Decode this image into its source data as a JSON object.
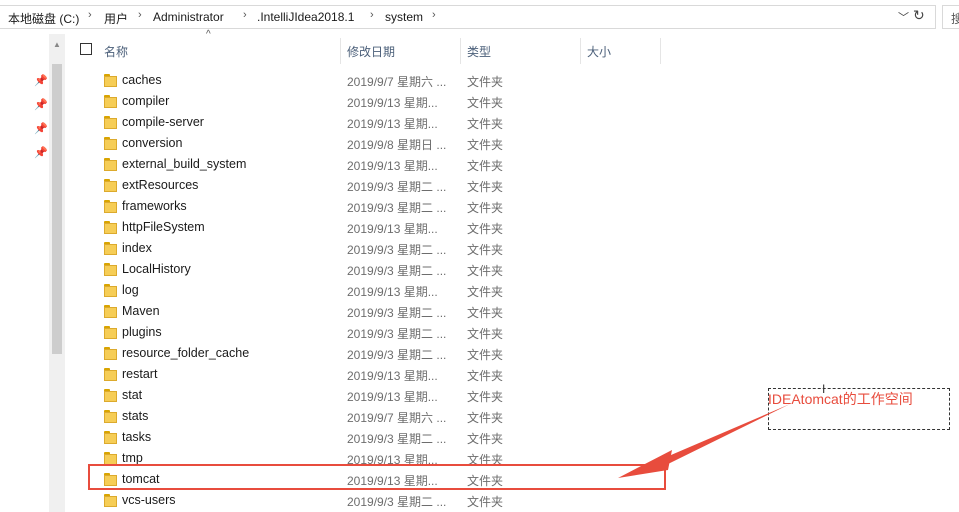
{
  "address_bar": {
    "crumbs": [
      "本地磁盘 (C:)",
      "用户",
      "Administrator",
      ".IntelliJIdea2018.1",
      "system"
    ],
    "dropdown_icon": "chevron-down-icon",
    "refresh_icon": "refresh-icon",
    "search_stub": "搜"
  },
  "columns": {
    "name": "名称",
    "modified": "修改日期",
    "type": "类型",
    "size": "大小"
  },
  "rows": [
    {
      "name": "caches",
      "date": "2019/9/7 星期六 ...",
      "type": "文件夹"
    },
    {
      "name": "compiler",
      "date": "2019/9/13 星期...",
      "type": "文件夹"
    },
    {
      "name": "compile-server",
      "date": "2019/9/13 星期...",
      "type": "文件夹"
    },
    {
      "name": "conversion",
      "date": "2019/9/8 星期日 ...",
      "type": "文件夹"
    },
    {
      "name": "external_build_system",
      "date": "2019/9/13 星期...",
      "type": "文件夹"
    },
    {
      "name": "extResources",
      "date": "2019/9/3 星期二 ...",
      "type": "文件夹"
    },
    {
      "name": "frameworks",
      "date": "2019/9/3 星期二 ...",
      "type": "文件夹"
    },
    {
      "name": "httpFileSystem",
      "date": "2019/9/13 星期...",
      "type": "文件夹"
    },
    {
      "name": "index",
      "date": "2019/9/3 星期二 ...",
      "type": "文件夹"
    },
    {
      "name": "LocalHistory",
      "date": "2019/9/3 星期二 ...",
      "type": "文件夹"
    },
    {
      "name": "log",
      "date": "2019/9/13 星期...",
      "type": "文件夹"
    },
    {
      "name": "Maven",
      "date": "2019/9/3 星期二 ...",
      "type": "文件夹"
    },
    {
      "name": "plugins",
      "date": "2019/9/3 星期二 ...",
      "type": "文件夹"
    },
    {
      "name": "resource_folder_cache",
      "date": "2019/9/3 星期二 ...",
      "type": "文件夹"
    },
    {
      "name": "restart",
      "date": "2019/9/13 星期...",
      "type": "文件夹"
    },
    {
      "name": "stat",
      "date": "2019/9/13 星期...",
      "type": "文件夹"
    },
    {
      "name": "stats",
      "date": "2019/9/7 星期六 ...",
      "type": "文件夹"
    },
    {
      "name": "tasks",
      "date": "2019/9/3 星期二 ...",
      "type": "文件夹"
    },
    {
      "name": "tmp",
      "date": "2019/9/13 星期...",
      "type": "文件夹"
    },
    {
      "name": "tomcat",
      "date": "2019/9/13 星期...",
      "type": "文件夹"
    },
    {
      "name": "vcs-users",
      "date": "2019/9/3 星期二 ...",
      "type": "文件夹"
    }
  ],
  "annotation": {
    "text": "IDEAtomcat的工作空间",
    "color": "#e84c3d"
  },
  "icons": {
    "pin": "pin-icon",
    "folder": "folder-icon"
  }
}
